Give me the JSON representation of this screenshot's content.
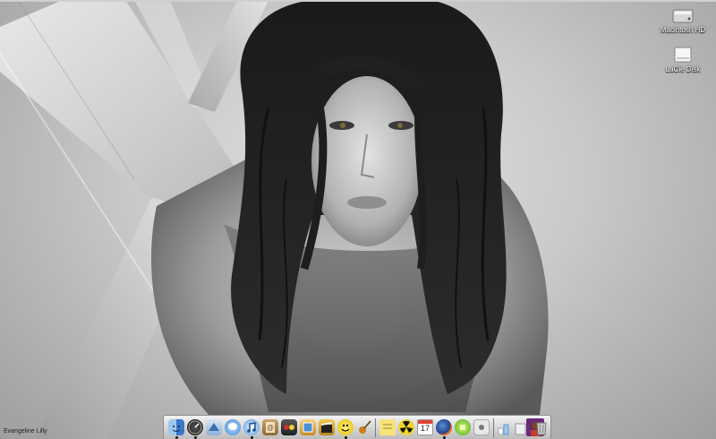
{
  "desktop": {
    "icons": [
      {
        "label": "Macintosh HD",
        "icon": "hard-drive-icon"
      },
      {
        "label": "LaCie Disk",
        "icon": "external-drive-icon"
      }
    ],
    "wallpaper_caption": "Evangeline Lilly"
  },
  "dock": {
    "apps": [
      {
        "icon": "finder-icon",
        "running": true
      },
      {
        "icon": "dashboard-icon",
        "running": true
      },
      {
        "icon": "mail-icon",
        "running": false
      },
      {
        "icon": "ichat-icon",
        "running": false
      },
      {
        "icon": "itunes-icon",
        "running": true
      },
      {
        "icon": "address-book-icon",
        "running": false
      },
      {
        "icon": "imovie-icon",
        "running": false
      },
      {
        "icon": "iphoto-icon",
        "running": false
      },
      {
        "icon": "clapperboard-icon",
        "running": false
      },
      {
        "icon": "adium-duck-icon",
        "running": true
      },
      {
        "icon": "garageband-guitar-icon",
        "running": false
      },
      {
        "icon": "stickies-icon",
        "running": false
      },
      {
        "icon": "radioactive-icon",
        "running": false
      },
      {
        "icon": "ical-icon",
        "running": false
      },
      {
        "icon": "firefox-icon",
        "running": true
      },
      {
        "icon": "green-app-icon",
        "running": false
      },
      {
        "icon": "preview-icon",
        "running": false
      }
    ],
    "calendar_day": "17",
    "right_items": [
      {
        "icon": "applications-stack-icon"
      },
      {
        "icon": "documents-stack-icon"
      },
      {
        "icon": "user-photo-icon"
      },
      {
        "icon": "minimized-window-icon"
      },
      {
        "icon": "trash-icon"
      }
    ]
  }
}
